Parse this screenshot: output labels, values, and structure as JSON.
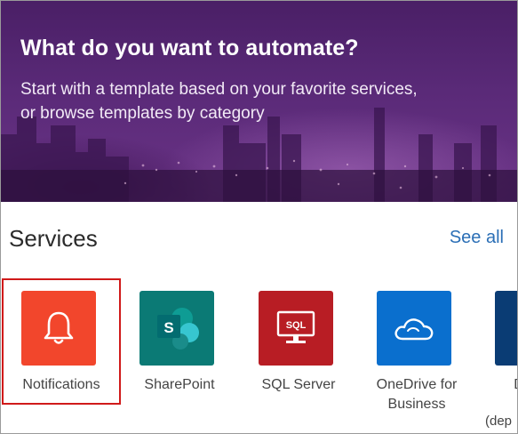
{
  "hero": {
    "title": "What do you want to automate?",
    "subtitle_line1": "Start with a template based on your favorite services,",
    "subtitle_line2": "or browse templates by category"
  },
  "services": {
    "heading": "Services",
    "see_all_label": "See all",
    "items": [
      {
        "label": "Notifications",
        "icon": "bell-icon",
        "color": "#f2462c",
        "selected": true
      },
      {
        "label": "SharePoint",
        "icon": "sharepoint-icon",
        "color": "#0b7a75"
      },
      {
        "label": "SQL Server",
        "icon": "sql-monitor-icon",
        "color": "#b81d24"
      },
      {
        "label": "OneDrive for Business",
        "icon": "cloud-icon",
        "color": "#0a6fce"
      },
      {
        "label": "Dy",
        "icon": "partial-tile",
        "color": "#0a3c74"
      }
    ],
    "overflow_text": "(dep"
  },
  "colors": {
    "hero_purple": "#5a2a78",
    "link_blue": "#2b6fb6",
    "selection_border": "#d01a1a"
  }
}
